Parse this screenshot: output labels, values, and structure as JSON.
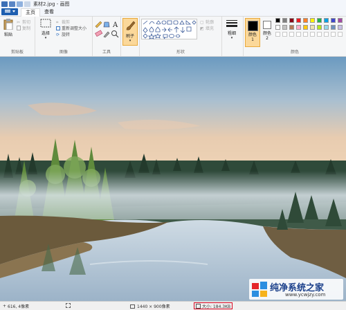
{
  "window": {
    "title": "素材2.jpg - 画图"
  },
  "tabs": {
    "home": "主页",
    "view": "查看"
  },
  "clipboard": {
    "paste": "粘贴",
    "cut": "剪切",
    "copy": "复制",
    "label": "剪贴板"
  },
  "image": {
    "select": "选择",
    "crop": "裁剪",
    "resize": "重新调整大小",
    "rotate": "旋转",
    "label": "图像"
  },
  "tools": {
    "label": "工具"
  },
  "brushes": {
    "label": "刷子"
  },
  "shapes": {
    "outline": "轮廓",
    "fill": "填充",
    "label": "形状"
  },
  "size": {
    "label": "粗细"
  },
  "colors": {
    "color1": "颜色 1",
    "color2": "颜色 2",
    "label": "颜色",
    "color1_value": "#000000",
    "color2_value": "#ffffff",
    "palette": [
      "#000000",
      "#7f7f7f",
      "#880015",
      "#ed1c24",
      "#ff7f27",
      "#fff200",
      "#22b14c",
      "#00a2e8",
      "#3f48cc",
      "#a349a4",
      "#ffffff",
      "#c3c3c3",
      "#b97a57",
      "#ffaec9",
      "#ffc90e",
      "#efe4b0",
      "#b5e61d",
      "#99d9ea",
      "#7092be",
      "#c8bfe7",
      "#ffffff",
      "#ffffff",
      "#ffffff",
      "#ffffff",
      "#ffffff",
      "#ffffff",
      "#ffffff",
      "#ffffff",
      "#ffffff",
      "#ffffff"
    ]
  },
  "status": {
    "cursor_pos": "616, 4像素",
    "dimensions": "1440 × 900像素",
    "file_size": "大小: 184.3KB"
  },
  "watermark": {
    "brand": "纯净系统之家",
    "url": "www.ycwjzy.com"
  }
}
